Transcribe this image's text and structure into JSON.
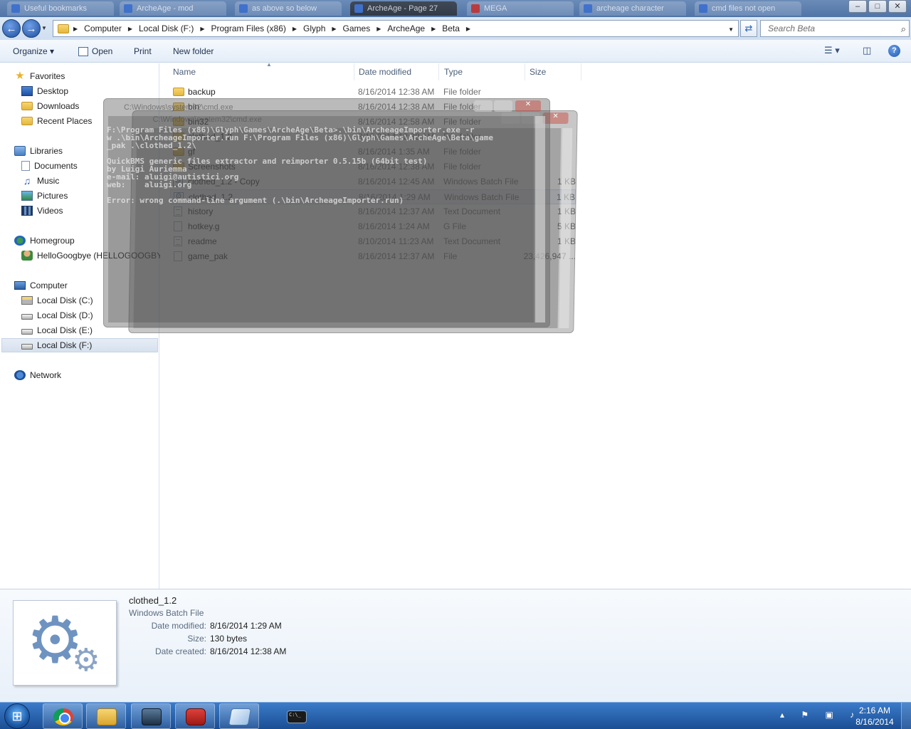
{
  "background_tabs": [
    {
      "label": "Useful bookmarks"
    },
    {
      "label": "ArcheAge - mod"
    },
    {
      "label": "as above so below"
    },
    {
      "label": "ArcheAge - Page 27"
    },
    {
      "label": "MEGA"
    },
    {
      "label": "archeage character"
    },
    {
      "label": "cmd files not open"
    }
  ],
  "window_controls": {
    "minimize": "–",
    "maximize": "□",
    "close": "✕"
  },
  "navigation": {
    "back_icon": "←",
    "forward_icon": "→",
    "history_drop": "▼"
  },
  "address_bar": {
    "crumbs": [
      "Computer",
      "Local Disk (F:)",
      "Program Files (x86)",
      "Glyph",
      "Games",
      "ArcheAge",
      "Beta"
    ],
    "separator": "▶",
    "dropdown": "▼",
    "refresh_icon": "⇄"
  },
  "search": {
    "placeholder": "Search Beta",
    "icon": "⌕"
  },
  "toolbar": {
    "organize": "Organize ▾",
    "open": "Open",
    "print": "Print",
    "new_folder": "New folder",
    "views_icon": "☰ ▾",
    "preview_pane_icon": "◫",
    "help_icon": "?"
  },
  "nav_pane": {
    "favorites": "Favorites",
    "desktop": "Desktop",
    "downloads": "Downloads",
    "recent_places": "Recent Places",
    "libraries": "Libraries",
    "documents": "Documents",
    "music": "Music",
    "pictures": "Pictures",
    "videos": "Videos",
    "homegroup": "Homegroup",
    "homegroup_user": "HelloGoogbye (HELLOGOOGBYE",
    "computer": "Computer",
    "disk_c": "Local Disk (C:)",
    "disk_d": "Local Disk (D:)",
    "disk_e": "Local Disk (E:)",
    "disk_f": "Local Disk (F:)",
    "network": "Network"
  },
  "columns": {
    "name": "Name",
    "date": "Date modified",
    "type": "Type",
    "size": "Size",
    "sort_arrow": "▲"
  },
  "files": [
    {
      "name": "backup",
      "date": "8/16/2014 12:38 AM",
      "type": "File folder",
      "size": "",
      "icon": "folder"
    },
    {
      "name": "bin",
      "date": "8/16/2014 12:38 AM",
      "type": "File folder",
      "size": "",
      "icon": "folder"
    },
    {
      "name": "bin32",
      "date": "8/16/2014 12:58 AM",
      "type": "File folder",
      "size": "",
      "icon": "folder"
    },
    {
      "name": "clothed_1.2",
      "date": "8/16/2014 12:38 AM",
      "type": "File folder",
      "size": "",
      "icon": "folder"
    },
    {
      "name": "gf",
      "date": "8/16/2014 1:35 AM",
      "type": "File folder",
      "size": "",
      "icon": "folder"
    },
    {
      "name": "Screenshots",
      "date": "8/16/2014 12:38 AM",
      "type": "File folder",
      "size": "",
      "icon": "folder"
    },
    {
      "name": "clothed_1.2 - Copy",
      "date": "8/16/2014 12:45 AM",
      "type": "Windows Batch File",
      "size": "1 KB",
      "icon": "batch"
    },
    {
      "name": "clothed_1.2",
      "date": "8/16/2014 1:29 AM",
      "type": "Windows Batch File",
      "size": "1 KB",
      "icon": "batch"
    },
    {
      "name": "history",
      "date": "8/16/2014 12:37 AM",
      "type": "Text Document",
      "size": "1 KB",
      "icon": "text"
    },
    {
      "name": "hotkey.g",
      "date": "8/16/2014 1:24 AM",
      "type": "G File",
      "size": "5 KB",
      "icon": "plain"
    },
    {
      "name": "readme",
      "date": "8/10/2014 11:23 AM",
      "type": "Text Document",
      "size": "1 KB",
      "icon": "text"
    },
    {
      "name": "game_pak",
      "date": "8/16/2014 12:37 AM",
      "type": "File",
      "size": "23,426,947 ...",
      "icon": "plain"
    }
  ],
  "ghost_windows": {
    "title_one": "C:\\Windows\\system32\\cmd.exe",
    "title_two": "C:\\Windows\\system32\\cmd.exe",
    "close": "✕",
    "console_lines": [
      "F:\\Program Files (x86)\\Glyph\\Games\\ArcheAge\\Beta>.\\bin\\ArcheageImporter.exe -r",
      "w .\\bin\\ArcheageImporter.run F:\\Program Files (x86)\\Glyph\\Games\\ArcheAge\\Beta\\game",
      "_pak .\\clothed_1.2\\",
      "",
      "QuickBMS generic files extractor and reimporter 0.5.15b (64bit test)",
      "by Luigi Auriemma",
      "e-mail: aluigi@autistici.org",
      "web:    aluigi.org",
      "",
      "Error: wrong command-line argument (.\\bin\\ArcheageImporter.run)"
    ]
  },
  "details": {
    "name": "clothed_1.2",
    "type": "Windows Batch File",
    "date_modified_label": "Date modified:",
    "date_modified": "8/16/2014 1:29 AM",
    "size_label": "Size:",
    "size": "130 bytes",
    "date_created_label": "Date created:",
    "date_created": "8/16/2014 12:38 AM"
  },
  "taskbar": {
    "start_icon": "⊞",
    "tray_icons": "▴ ⚑ ▣ ♪",
    "time": "2:16 AM",
    "date": "8/16/2014",
    "cmd_label": "C:\\_"
  }
}
